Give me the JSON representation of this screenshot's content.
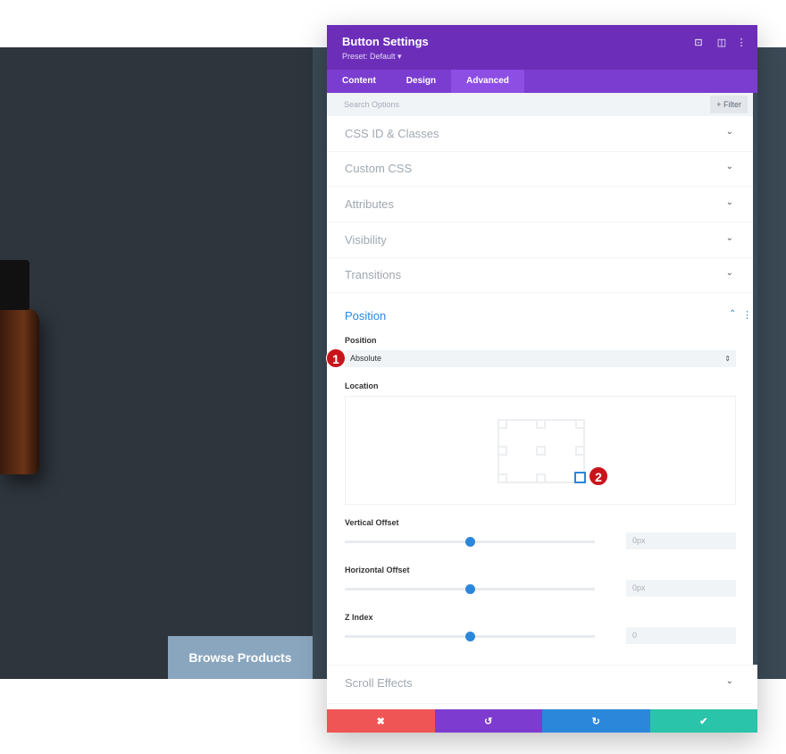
{
  "page": {
    "browse_button": "Browse Products"
  },
  "panel": {
    "title": "Button Settings",
    "preset": "Preset: Default ▾",
    "tabs": [
      {
        "label": "Content"
      },
      {
        "label": "Design"
      },
      {
        "label": "Advanced",
        "active": true
      }
    ],
    "search_placeholder": "Search Options",
    "filter_label": "+ Filter",
    "sections": [
      "CSS ID & Classes",
      "Custom CSS",
      "Attributes",
      "Visibility",
      "Transitions"
    ],
    "position": {
      "title": "Position",
      "position_label": "Position",
      "position_value": "Absolute",
      "location_label": "Location",
      "location_selected": "bottom-right",
      "vertical_offset": {
        "label": "Vertical Offset",
        "value": "0px",
        "slider_percent": 50
      },
      "horizontal_offset": {
        "label": "Horizontal Offset",
        "value": "0px",
        "slider_percent": 50
      },
      "z_index": {
        "label": "Z Index",
        "value": "0",
        "slider_percent": 50
      }
    },
    "scroll_effects": "Scroll Effects",
    "footer": {
      "cancel": "✖",
      "undo": "↺",
      "redo": "↻",
      "save": "✔"
    },
    "colors": {
      "header": "#6c2eb9",
      "accent": "#2b87da",
      "cancel": "#ef5555",
      "undo": "#7e3bd0",
      "redo": "#2b87da",
      "save": "#29c4a9"
    }
  },
  "annotations": [
    "1",
    "2"
  ]
}
